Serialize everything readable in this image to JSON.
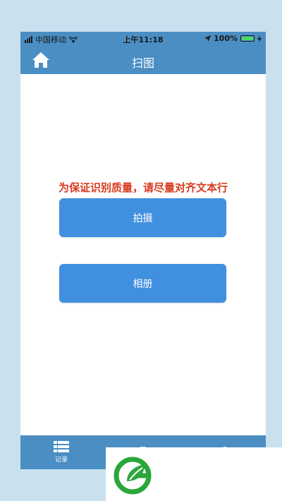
{
  "status_bar": {
    "carrier": "中国移动",
    "time": "上午11:18",
    "battery": "100%"
  },
  "nav": {
    "title": "扫图",
    "home_icon": "home-icon"
  },
  "main": {
    "hint": "为保证识别质量，请尽量对齐文本行",
    "shoot_label": "拍摄",
    "album_label": "相册"
  },
  "tabs": [
    {
      "label": "记录",
      "icon": "list-icon"
    },
    {
      "label": "",
      "icon": "camera-icon"
    },
    {
      "label": "",
      "icon": "user-icon"
    }
  ],
  "colors": {
    "background": "#c9e0ef",
    "bar": "#4a8ec4",
    "button": "#4190e0",
    "hint": "#d93a1f",
    "logo_green": "#2aa63a"
  }
}
